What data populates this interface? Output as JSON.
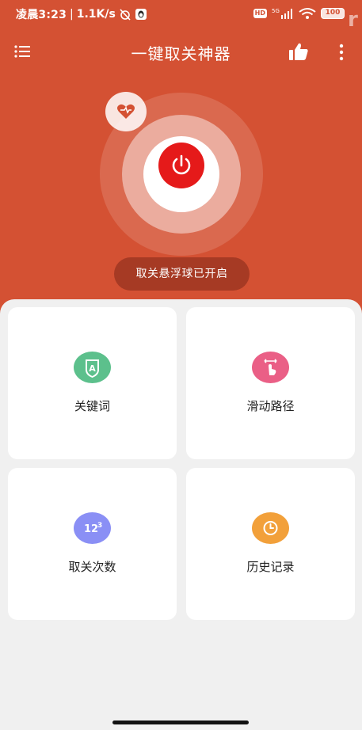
{
  "status_bar": {
    "time": "凌晨3:23",
    "speed": "1.1K/s",
    "network_badge": "HD",
    "signal_label": "5G",
    "battery": "100"
  },
  "toolbar": {
    "title": "一键取关神器"
  },
  "hero": {
    "float_status": "取关悬浮球已开启"
  },
  "cards": [
    {
      "label": "关键词",
      "icon": "keyword-icon",
      "color": "#5cc08c"
    },
    {
      "label": "滑动路径",
      "icon": "swipe-path-icon",
      "color": "#ea5f86"
    },
    {
      "label": "取关次数",
      "icon": "count-123-icon",
      "color": "#8a8ff5"
    },
    {
      "label": "历史记录",
      "icon": "history-clock-icon",
      "color": "#f2a03a"
    }
  ],
  "colors": {
    "primary": "#d45133",
    "power_button": "#e51a1a",
    "pill": "#a63a24",
    "background": "#f0f0f0"
  }
}
